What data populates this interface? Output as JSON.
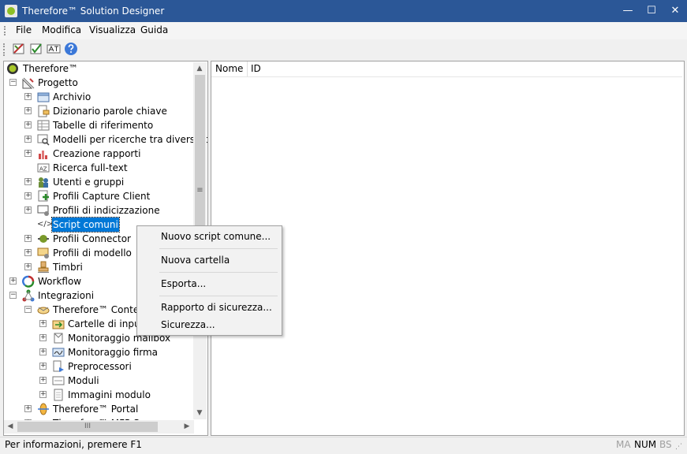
{
  "window": {
    "title": "Therefore™ Solution Designer",
    "minimize": "—",
    "maximize": "☐",
    "close": "✕"
  },
  "menu": {
    "items": [
      "File",
      "Modifica",
      "Visualizza",
      "Guida"
    ]
  },
  "tree": {
    "root": "Therefore™",
    "project": "Progetto",
    "project_items": [
      "Archivio",
      "Dizionario parole chiave",
      "Tabelle di riferimento",
      "Modelli per ricerche tra diverse categorie",
      "Creazione rapporti",
      "Ricerca full-text",
      "Utenti e gruppi",
      "Profili Capture Client",
      "Profili di indicizzazione",
      "Script comuni",
      "Profili Connector",
      "Profili di modello",
      "Timbri"
    ],
    "workflow": "Workflow",
    "integrations": "Integrazioni",
    "content": "Therefore™ Content Connector",
    "content_items": [
      "Cartelle di input",
      "Monitoraggio mailbox",
      "Monitoraggio firma",
      "Preprocessori",
      "Moduli",
      "Immagini modulo"
    ],
    "portal": "Therefore™ Portal",
    "mfp": "Therefore™ MFP Scan"
  },
  "list": {
    "columns": [
      "Nome",
      "ID"
    ]
  },
  "context_menu": {
    "items": [
      "Nuovo script comune...",
      "Nuova cartella",
      "Esporta...",
      "Rapporto di sicurezza...",
      "Sicurezza..."
    ]
  },
  "status": {
    "text": "Per informazioni, premere F1",
    "ind_caps": "MA",
    "ind_num": "NUM",
    "ind_scroll": "BS"
  },
  "scrollbar": {
    "up": "▲",
    "down": "▼",
    "left": "◀",
    "right": "▶",
    "grip_v": "≡",
    "grip_h": "III"
  },
  "colors": {
    "titlebar": "#2b5797",
    "selection": "#0078d7",
    "root_icon": "#8cbf26"
  }
}
